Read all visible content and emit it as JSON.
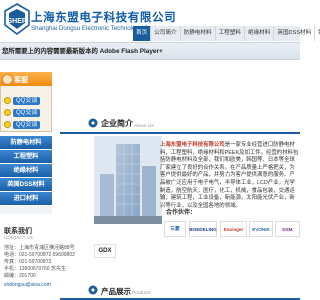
{
  "header": {
    "logo_text": "SHEP",
    "company_cn": "上海东盟电子科技有限公司",
    "company_en": "Shanghai Dongsu Electronic Technology Co.,Ltd."
  },
  "nav": {
    "items": [
      "首页",
      "公司简介",
      "防静电材料",
      "工程塑料",
      "绝缘材料",
      "英国DSS材料",
      "销售"
    ]
  },
  "banner": {
    "flash_notice": "您所需要上的内容需要最新版本的 Adobe Flash Player+"
  },
  "service": {
    "title": "客服",
    "qq": [
      "QQ交谈",
      "QQ交谈",
      "QQ交谈"
    ]
  },
  "categories": [
    "防静电材料",
    "工程塑料",
    "绝缘材料",
    "英国DSS材料",
    "进口材料"
  ],
  "contact": {
    "title": "联系我们",
    "title_en": "CONTACT US",
    "lines": [
      "地址：上海市青浦区横泾路88号",
      "电话：021-59700872 59699802",
      "传真：021-59700873",
      "手机：13900670760 苏先生",
      "邮编：201700",
      "shdongsu@sina.com"
    ]
  },
  "intro": {
    "title": "企业简介",
    "title_en": "About Us",
    "lead": "上海东盟电子科技有限公司",
    "body": "是一家专业经营进口防静电材料，工程塑料，绝缘材料和PEEK及加工件。经营的材料包括防静电材料及全部，我们和欧美，韩国等、日本等全球厂家建立了良好的合作关系。在产品质量上严格把关，为客户提供最好的产品，并努力为客户提供满意的服务。产品被广泛应用于电子电气，半导体工业，LCD产业，光学制造，航空航天，医疗，化工，机械，食品包装，交通运输，建筑工程，工业设备，新能源，太阳能光伏产业，新兴等行业，以及全国各地的领域。",
    "partners_label": "合作伙伴：",
    "partners": [
      "三菱",
      "BOEDELING",
      "Ensinger",
      "EVONIK",
      "DSM"
    ]
  },
  "gdx_logo": "GDX",
  "products": {
    "title": "产品展示",
    "title_en": "Products"
  },
  "colors": {
    "brand_blue": "#1a5d9f",
    "accent_orange": "#f08a12",
    "category_blue": "#2d78c6"
  }
}
